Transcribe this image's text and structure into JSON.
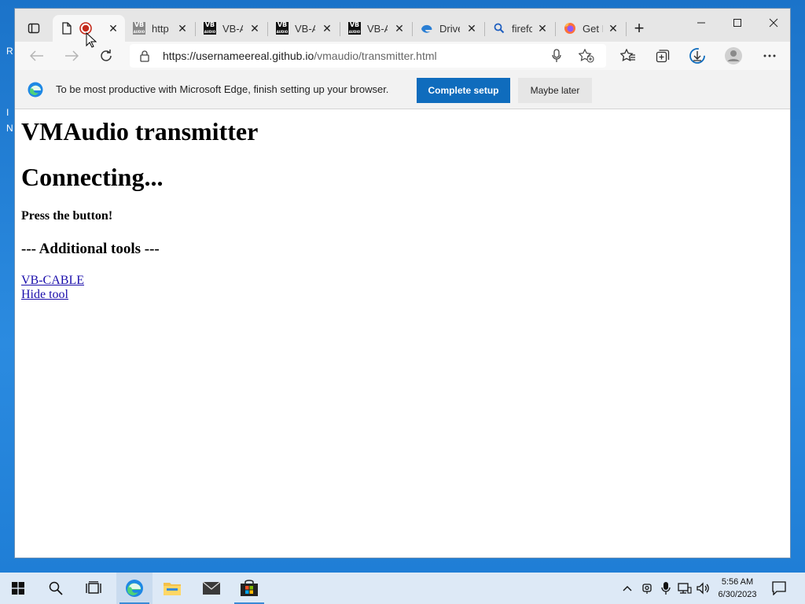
{
  "desktop": {
    "glyphs": [
      "R",
      "I",
      "N"
    ]
  },
  "tabs": [
    {
      "label": "",
      "favicon": "record-icon"
    },
    {
      "label": "http",
      "favicon": "vb-icon"
    },
    {
      "label": "VB-A",
      "favicon": "vb-icon"
    },
    {
      "label": "VB-A",
      "favicon": "vb-icon"
    },
    {
      "label": "VB-A",
      "favicon": "vb-icon"
    },
    {
      "label": "Drive",
      "favicon": "edge-drive-icon"
    },
    {
      "label": "firefo",
      "favicon": "search-icon"
    },
    {
      "label": "Get I",
      "favicon": "firefox-icon"
    }
  ],
  "vb_favicon_text": {
    "line1": "VB",
    "line2": "AUDIO"
  },
  "address": {
    "host": "https://usernameereal.github.io",
    "path": "/vmaudio/transmitter.html"
  },
  "infobar": {
    "message": "To be most productive with Microsoft Edge, finish setting up your browser.",
    "primary_label": "Complete setup",
    "secondary_label": "Maybe later"
  },
  "page": {
    "title": "VMAudio transmitter",
    "status": "Connecting...",
    "instruction": "Press the button!",
    "tools_heading": "--- Additional tools ---",
    "links": [
      "VB-CABLE",
      "Hide tool"
    ]
  },
  "clock": {
    "time": "5:56 AM",
    "date": "6/30/2023"
  },
  "colors": {
    "accent": "#0f6cbd",
    "link": "#1a0dab",
    "desktop": "#1f7fd6"
  }
}
